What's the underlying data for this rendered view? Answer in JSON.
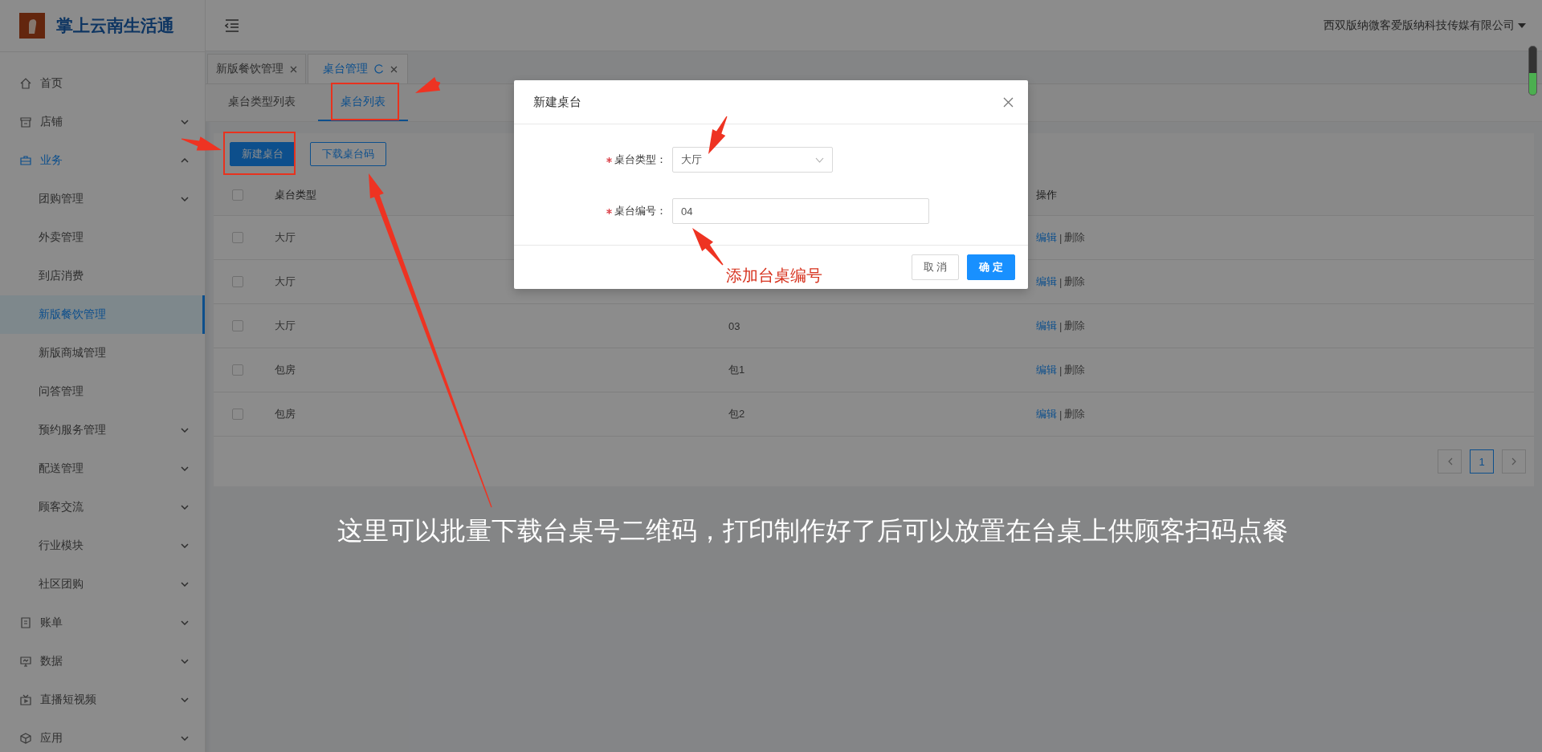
{
  "app": {
    "title": "掌上云南生活通"
  },
  "header": {
    "account": "西双版纳微客爱版纳科技传媒有限公司"
  },
  "sidebar": {
    "items": [
      {
        "label": "首页",
        "kind": "link",
        "selected": false
      },
      {
        "label": "店铺",
        "kind": "submenu",
        "expanded": false,
        "selected": false
      },
      {
        "label": "业务",
        "kind": "submenu",
        "expanded": true,
        "selected": false,
        "children": [
          {
            "label": "团购管理",
            "kind": "submenu",
            "expanded": false,
            "selected": false
          },
          {
            "label": "外卖管理",
            "kind": "link",
            "selected": false
          },
          {
            "label": "到店消费",
            "kind": "link",
            "selected": false
          },
          {
            "label": "新版餐饮管理",
            "kind": "link",
            "selected": true
          },
          {
            "label": "新版商城管理",
            "kind": "link",
            "selected": false
          },
          {
            "label": "问答管理",
            "kind": "link",
            "selected": false
          },
          {
            "label": "预约服务管理",
            "kind": "submenu",
            "expanded": false,
            "selected": false
          },
          {
            "label": "配送管理",
            "kind": "submenu",
            "expanded": false,
            "selected": false
          },
          {
            "label": "顾客交流",
            "kind": "submenu",
            "expanded": false,
            "selected": false
          },
          {
            "label": "行业模块",
            "kind": "submenu",
            "expanded": false,
            "selected": false
          },
          {
            "label": "社区团购",
            "kind": "submenu",
            "expanded": false,
            "selected": false
          }
        ]
      },
      {
        "label": "账单",
        "kind": "submenu",
        "expanded": false,
        "selected": false
      },
      {
        "label": "数据",
        "kind": "submenu",
        "expanded": false,
        "selected": false
      },
      {
        "label": "直播短视频",
        "kind": "submenu",
        "expanded": false,
        "selected": false
      },
      {
        "label": "应用",
        "kind": "submenu",
        "expanded": false,
        "selected": false
      }
    ]
  },
  "tabs": [
    {
      "label": "新版餐饮管理",
      "selected": false
    },
    {
      "label": "桌台管理",
      "selected": true
    }
  ],
  "subtabs": [
    {
      "label": "桌台类型列表",
      "selected": false
    },
    {
      "label": "桌台列表",
      "selected": true
    }
  ],
  "toolbar": {
    "buttons": [
      {
        "label": "新建桌台",
        "kind": "primary"
      },
      {
        "label": "下载桌台码",
        "kind": "outline"
      }
    ]
  },
  "table": {
    "header": {
      "checked": false,
      "column_1": "桌台类型",
      "column_3": "操作"
    },
    "rows": [
      {
        "checked": false,
        "column_1": "大厅",
        "actions": [
          {
            "label": "编辑",
            "kind": "edit"
          },
          {
            "label": "删除",
            "kind": "delete"
          }
        ],
        "separator": "|"
      },
      {
        "checked": false,
        "column_1": "大厅",
        "actions": [
          {
            "label": "编辑",
            "kind": "edit"
          },
          {
            "label": "删除",
            "kind": "delete"
          }
        ],
        "separator": "|"
      },
      {
        "checked": false,
        "column_1": "大厅",
        "column_2": "03",
        "actions": [
          {
            "label": "编辑",
            "kind": "edit"
          },
          {
            "label": "删除",
            "kind": "delete"
          }
        ],
        "separator": "|"
      },
      {
        "checked": false,
        "column_1": "包房",
        "column_2": "包1",
        "actions": [
          {
            "label": "编辑",
            "kind": "edit"
          },
          {
            "label": "删除",
            "kind": "delete"
          }
        ],
        "separator": "|"
      },
      {
        "checked": false,
        "column_1": "包房",
        "column_2": "包2",
        "actions": [
          {
            "label": "编辑",
            "kind": "edit"
          },
          {
            "label": "删除",
            "kind": "delete"
          }
        ],
        "separator": "|"
      }
    ]
  },
  "pagination": {
    "pages": [
      {
        "label": "1",
        "selected": true
      }
    ]
  },
  "dialog": {
    "title": "新建桌台",
    "fields": [
      {
        "label": "桌台类型：",
        "kind": "select",
        "value": "大厅",
        "required": true
      },
      {
        "label": "桌台编号：",
        "kind": "input",
        "value": "04",
        "required": true
      }
    ],
    "buttons": [
      {
        "label": "取 消",
        "kind": "default"
      },
      {
        "label": "确 定",
        "kind": "primary"
      }
    ]
  },
  "annotations": [
    {
      "text": "添加台桌编号",
      "kind": "callout"
    },
    {
      "text": "这里可以批量下载台桌号二维码，打印制作好了后可以放置在台桌上供顾客扫码点餐",
      "kind": "caption"
    }
  ]
}
